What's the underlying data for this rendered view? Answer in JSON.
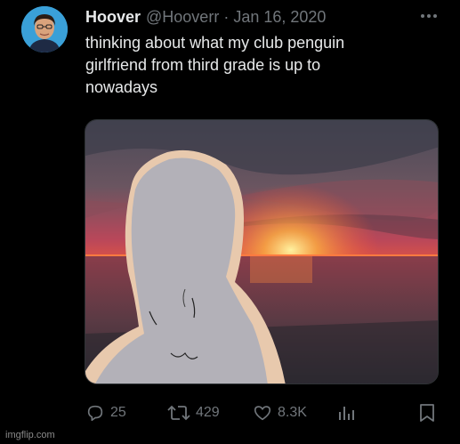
{
  "tweet": {
    "author_name": "Hoover",
    "handle": "@Hooverr",
    "separator": "·",
    "date": "Jan 16, 2020",
    "text_lines": [
      "thinking about what my club penguin",
      "girlfriend from third grade is up to",
      "nowadays"
    ]
  },
  "actions": {
    "reply_count": "25",
    "retweet_count": "429",
    "like_count": "8.3K"
  },
  "icons": {
    "more": "more-horizontal-icon",
    "reply": "reply-icon",
    "retweet": "retweet-icon",
    "like": "heart-icon",
    "views": "analytics-icon",
    "bookmark": "bookmark-icon"
  },
  "colors": {
    "background": "#000000",
    "text_primary": "#e7e9ea",
    "text_secondary": "#71767b"
  },
  "watermark": "imgflip.com"
}
